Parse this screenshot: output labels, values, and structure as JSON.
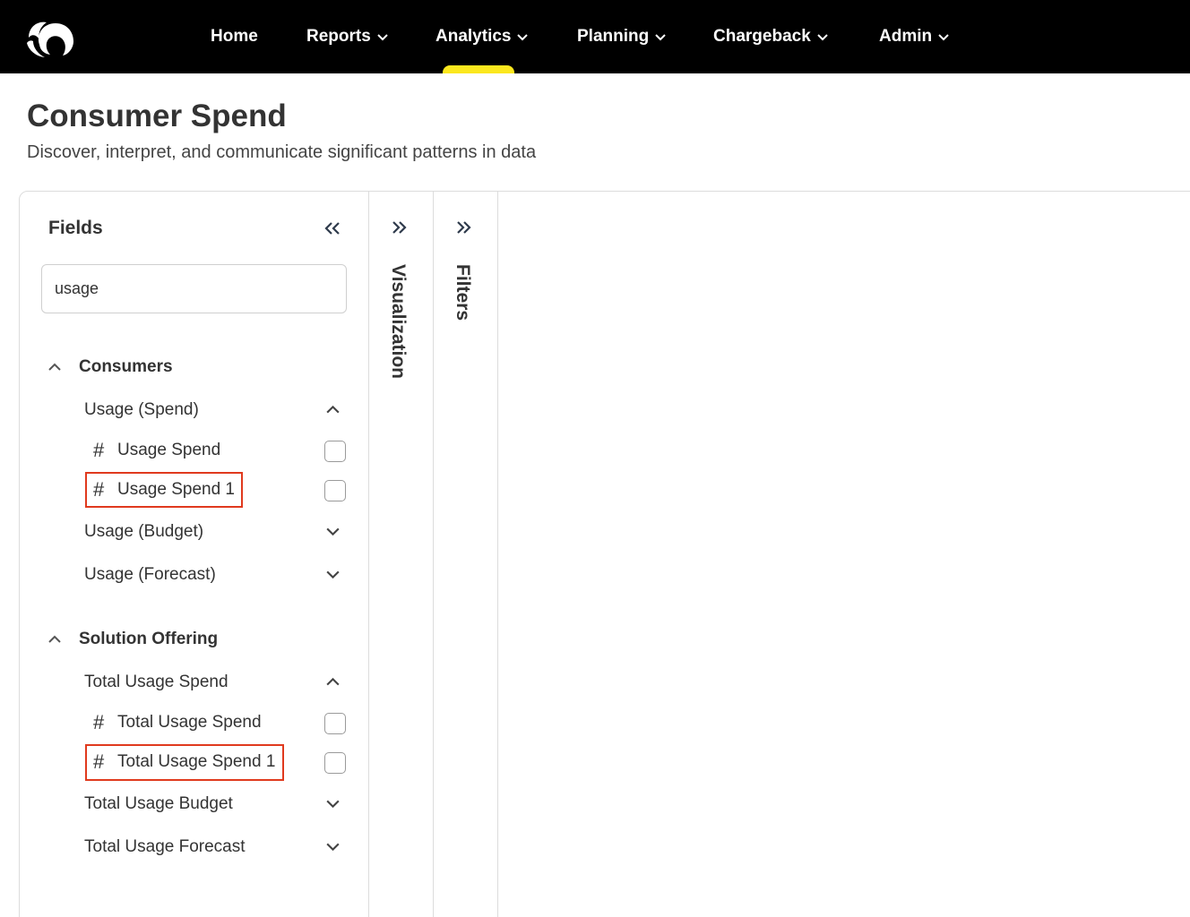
{
  "nav": {
    "items": [
      {
        "label": "Home",
        "has_dropdown": false
      },
      {
        "label": "Reports",
        "has_dropdown": true
      },
      {
        "label": "Analytics",
        "has_dropdown": true,
        "active": true
      },
      {
        "label": "Planning",
        "has_dropdown": true
      },
      {
        "label": "Chargeback",
        "has_dropdown": true
      },
      {
        "label": "Admin",
        "has_dropdown": true
      }
    ],
    "active_indicator_color": "#fbe71e",
    "logo_icon": "brand-logo-icon"
  },
  "page": {
    "title": "Consumer Spend",
    "subtitle": "Discover, interpret, and communicate significant patterns in data"
  },
  "fields_panel": {
    "title": "Fields",
    "search_value": "usage",
    "groups": [
      {
        "label": "Consumers",
        "expanded": true,
        "subgroups": [
          {
            "label": "Usage (Spend)",
            "expanded": true,
            "fields": [
              {
                "label": "Usage Spend",
                "checked": false,
                "highlighted": false
              },
              {
                "label": "Usage Spend 1",
                "checked": false,
                "highlighted": true
              }
            ]
          },
          {
            "label": "Usage (Budget)",
            "expanded": false
          },
          {
            "label": "Usage (Forecast)",
            "expanded": false
          }
        ]
      },
      {
        "label": "Solution Offering",
        "expanded": true,
        "subgroups": [
          {
            "label": "Total Usage Spend",
            "expanded": true,
            "fields": [
              {
                "label": "Total Usage Spend",
                "checked": false,
                "highlighted": false
              },
              {
                "label": "Total Usage Spend 1",
                "checked": false,
                "highlighted": true
              }
            ]
          },
          {
            "label": "Total Usage Budget",
            "expanded": false
          },
          {
            "label": "Total Usage Forecast",
            "expanded": false
          }
        ]
      }
    ],
    "field_type_symbol": "#"
  },
  "side_panels": {
    "visualization_label": "Visualization",
    "filters_label": "Filters"
  },
  "colors": {
    "nav_background": "#000000",
    "highlight_border": "#e03a1e"
  }
}
